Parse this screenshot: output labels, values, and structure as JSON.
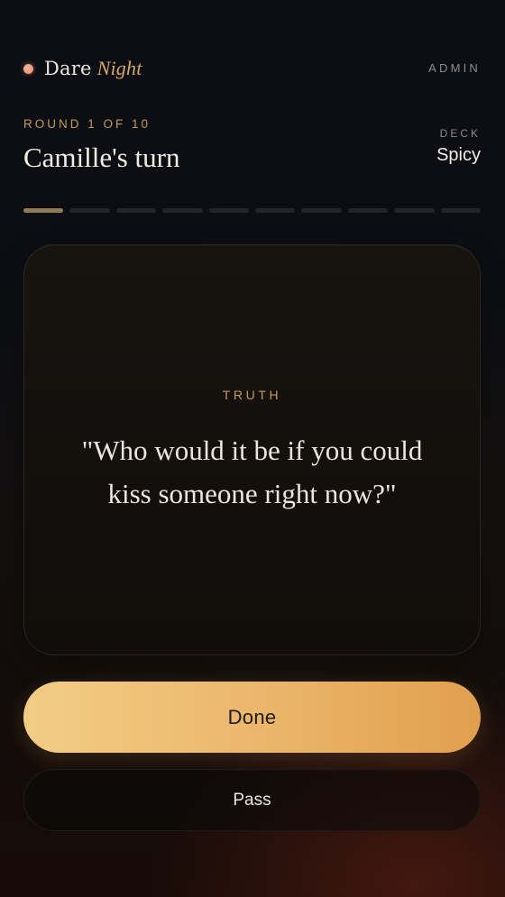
{
  "header": {
    "brand_main": "Dare",
    "brand_accent": "Night",
    "admin_label": "ADMIN"
  },
  "game": {
    "round_label": "ROUND 1 OF 10",
    "turn_label": "Camille's turn",
    "deck_label": "DECK",
    "deck_value": "Spicy",
    "progress": {
      "current": 1,
      "total": 10
    }
  },
  "card": {
    "type_label": "TRUTH",
    "prompt": "\"Who would it be if you could kiss someone right now?\""
  },
  "actions": {
    "done_label": "Done",
    "pass_label": "Pass"
  },
  "colors": {
    "accent": "#c49a57",
    "button_gradient_start": "#f3cd85",
    "button_gradient_end": "#e19f4e",
    "dot": "#e3876a"
  }
}
